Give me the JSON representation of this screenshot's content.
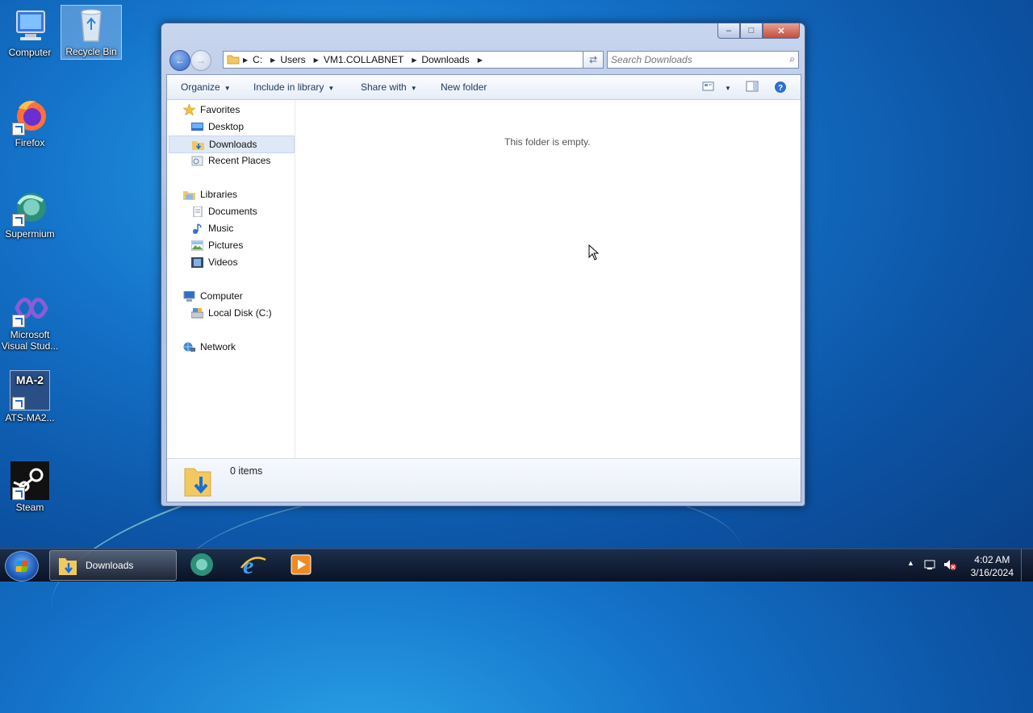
{
  "desktop": {
    "icons": [
      {
        "label": "Computer",
        "icon": "computer-icon"
      },
      {
        "label": "Recycle Bin",
        "icon": "recycle-bin-icon"
      },
      {
        "label": "Firefox",
        "icon": "firefox-icon"
      },
      {
        "label": "Supermium",
        "icon": "supermium-icon"
      },
      {
        "label": "Microsoft Visual Stud...",
        "icon": "visual-studio-icon"
      },
      {
        "label": "ATS-MA2...",
        "icon": "ma2-icon"
      },
      {
        "label": "Steam",
        "icon": "steam-icon"
      }
    ],
    "ma2_badge": "MA-2"
  },
  "window": {
    "title": "Downloads",
    "caption": {
      "minimize": "–",
      "maximize": "□",
      "close": "✕"
    },
    "address": {
      "crumbs": [
        "C:",
        "Users",
        "VM1.COLLABNET",
        "Downloads"
      ]
    },
    "search": {
      "placeholder": "Search Downloads"
    },
    "toolbar": {
      "organize": "Organize",
      "include": "Include in library",
      "share": "Share with",
      "new_folder": "New folder"
    },
    "nav": {
      "favorites": "Favorites",
      "desktop": "Desktop",
      "downloads": "Downloads",
      "recent": "Recent Places",
      "libraries": "Libraries",
      "documents": "Documents",
      "music": "Music",
      "pictures": "Pictures",
      "videos": "Videos",
      "computer": "Computer",
      "local_disk": "Local Disk (C:)",
      "network": "Network"
    },
    "content": {
      "empty_message": "This folder is empty."
    },
    "details": {
      "count": "0 items"
    }
  },
  "taskbar": {
    "task_label": "Downloads",
    "clock_time": "4:02 AM",
    "clock_date": "3/16/2024"
  },
  "colors": {
    "accent": "#1a6fd1",
    "folder": "#f2c960"
  }
}
